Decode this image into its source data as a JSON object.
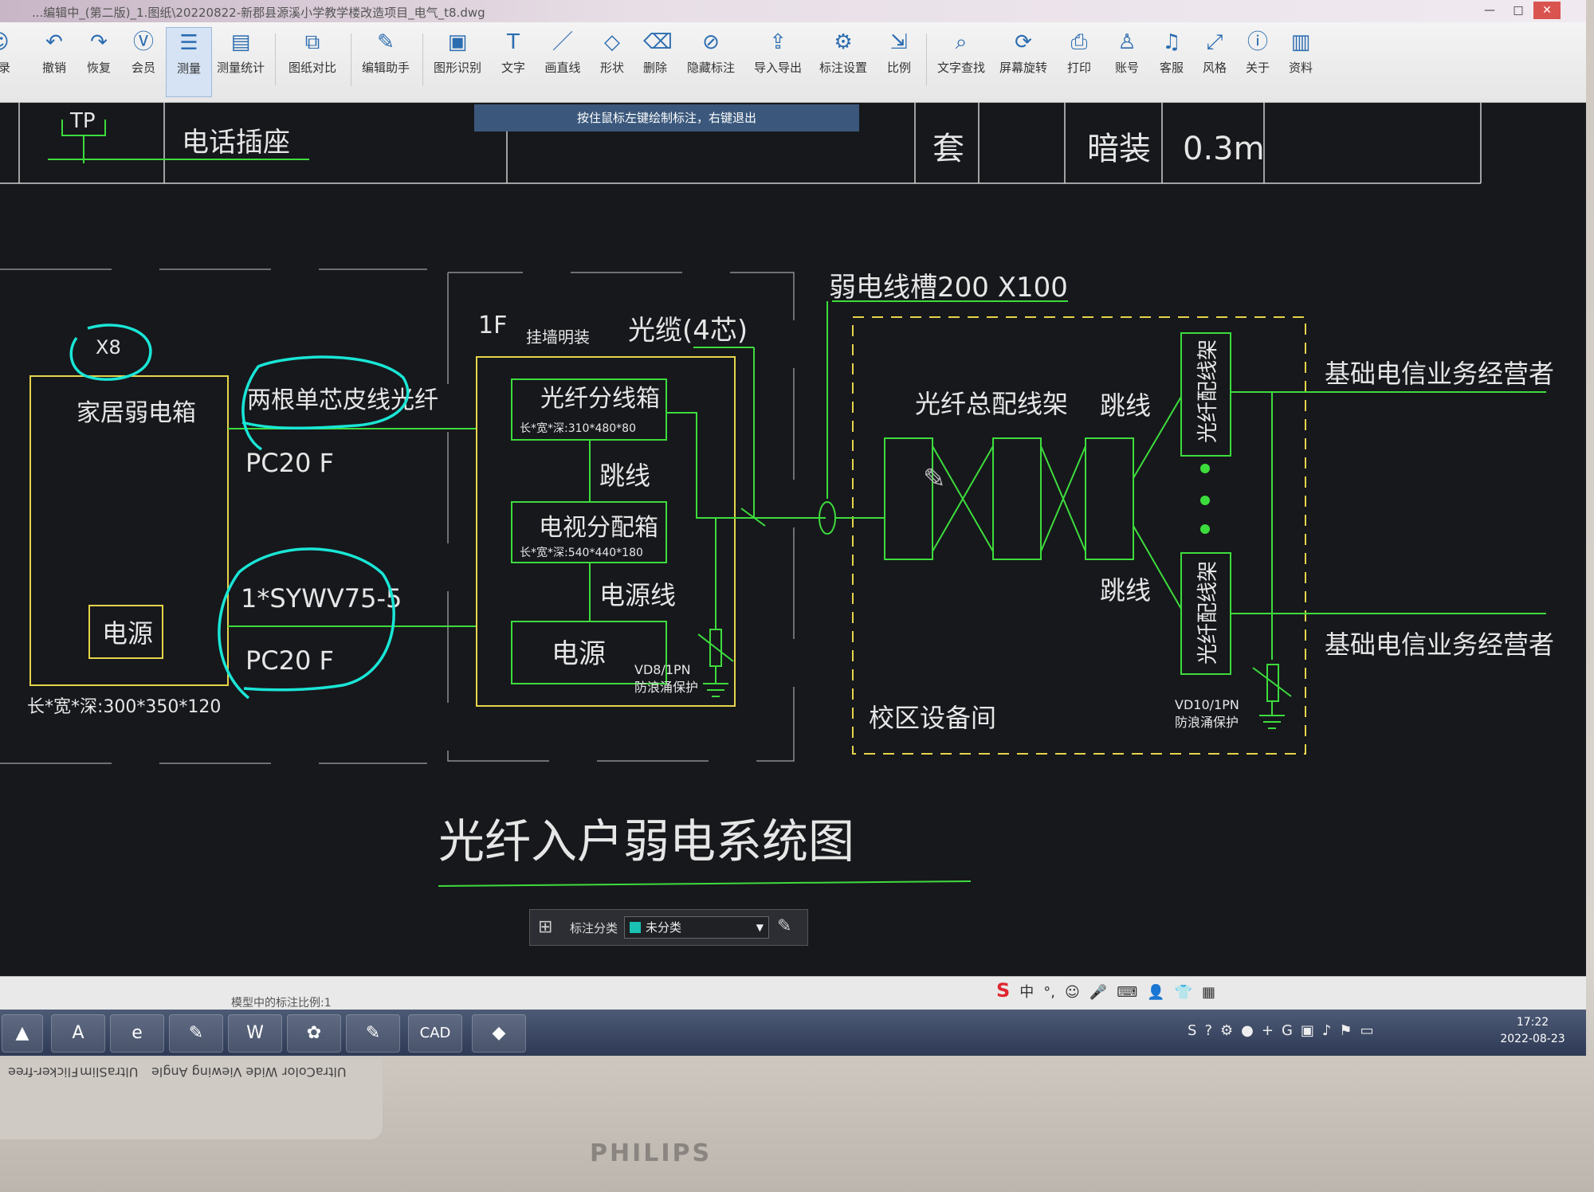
{
  "window": {
    "title": "...编辑中_(第二版)_1.图纸\\20220822-新郡县源溪小学教学楼改造项目_电气_t8.dwg",
    "min_label": "—",
    "max_label": "□",
    "close_label": "✕"
  },
  "toolbar": {
    "items": [
      {
        "label": "登录",
        "icon": "user-icon"
      },
      {
        "label": "撤销",
        "icon": "undo-icon"
      },
      {
        "label": "恢复",
        "icon": "redo-icon"
      },
      {
        "label": "会员",
        "icon": "vip-icon"
      },
      {
        "label": "测量",
        "icon": "measure-icon"
      },
      {
        "label": "测量统计",
        "icon": "stats-icon"
      },
      {
        "label": "图纸对比",
        "icon": "compare-icon"
      },
      {
        "label": "编辑助手",
        "icon": "edit-helper-icon"
      },
      {
        "label": "图形识别",
        "icon": "recognize-icon"
      },
      {
        "label": "文字",
        "icon": "text-icon"
      },
      {
        "label": "画直线",
        "icon": "line-icon"
      },
      {
        "label": "形状",
        "icon": "shape-icon"
      },
      {
        "label": "删除",
        "icon": "eraser-icon"
      },
      {
        "label": "隐藏标注",
        "icon": "hide-icon"
      },
      {
        "label": "导入导出",
        "icon": "import-export-icon"
      },
      {
        "label": "标注设置",
        "icon": "annotation-settings-icon"
      },
      {
        "label": "比例",
        "icon": "scale-icon"
      },
      {
        "label": "文字查找",
        "icon": "text-search-icon"
      },
      {
        "label": "屏幕旋转",
        "icon": "rotate-icon"
      },
      {
        "label": "打印",
        "icon": "print-icon"
      },
      {
        "label": "账号",
        "icon": "account-icon"
      },
      {
        "label": "客服",
        "icon": "headset-icon"
      },
      {
        "label": "风格",
        "icon": "style-icon"
      },
      {
        "label": "关于",
        "icon": "info-icon"
      },
      {
        "label": "资料",
        "icon": "docs-icon"
      }
    ]
  },
  "hint": "按住鼠标左键绘制标注，右键退出",
  "legend_row": {
    "symbol": "TP",
    "name": "电话插座",
    "unit": "套",
    "install": "暗装",
    "height": "0.3m"
  },
  "drawing": {
    "title": "光纤入户弱电系统图",
    "x8": "X8",
    "home_box": "家居弱电箱",
    "home_power": "电源",
    "home_size": "长*宽*深:300*350*120",
    "cable1": "两根单芯皮线光纤",
    "pc20_1": "PC20  F",
    "cable2": "1*SYWV75-5",
    "pc20_2": "PC20  F",
    "floor": "1F",
    "wall_mount": "挂墙明装",
    "fiber_cable": "光缆(4芯)",
    "fiber_box": "光纤分线箱",
    "fiber_box_size": "长*宽*深:310*480*80",
    "jumper": "跳线",
    "tv_box": "电视分配箱",
    "tv_box_size": "长*宽*深:540*440*180",
    "power_line": "电源线",
    "power": "电源",
    "vd8": "VD8/1PN",
    "surge1": "防浪涌保护",
    "trough": "弱电线槽200 X100",
    "odf": "光纤总配线架",
    "jumper_top": "跳线",
    "jumper_bottom": "跳线",
    "frame_top": "光纤配线架",
    "frame_bottom": "光纤配线架",
    "operator_top": "基础电信业务经营者",
    "operator_bottom": "基础电信业务经营者",
    "campus_room": "校区设备间",
    "vd10": "VD10/1PN",
    "surge2": "防浪涌保护"
  },
  "annot_bar": {
    "label": "标注分类",
    "value": "未分类"
  },
  "status": {
    "scale": "模型中的标注比例:1"
  },
  "ime": {
    "items": [
      "S",
      "中",
      "°,",
      "☺",
      "🎤",
      "⌨",
      "👤",
      "👕",
      "▦"
    ]
  },
  "taskbar": {
    "apps": [
      "pdf-icon",
      "autocad-icon",
      "ie-icon",
      "pen-icon",
      "wps-icon",
      "photo-icon",
      "pen2-icon",
      "cad-icon",
      "glodon-icon"
    ],
    "cad_label": "CAD",
    "time": "17:22",
    "date": "2022-08-23"
  },
  "bezel": {
    "brand": "PHILIPS",
    "stickers": [
      "Flicker-free",
      "UltraSlim",
      "Wide Viewing Angle",
      "UltraColor"
    ]
  },
  "colors": {
    "cad_bg": "#17181c",
    "green": "#3ddc3d",
    "yellow": "#e6d44a",
    "white": "#e6e6e6",
    "cyan_markup": "#19e6d6"
  }
}
